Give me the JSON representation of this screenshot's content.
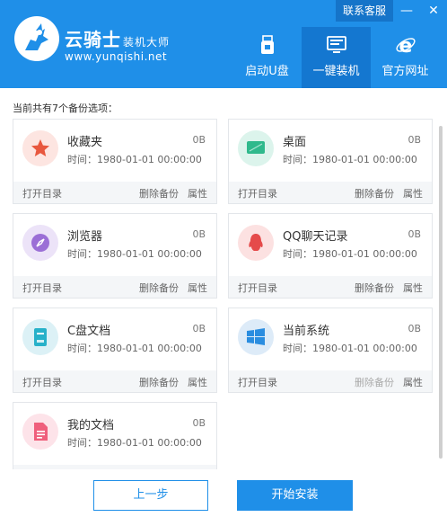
{
  "header": {
    "brand_name": "云骑士",
    "brand_sub": "装机大师",
    "brand_url": "www.yunqishi.net",
    "service_label": "联系客服",
    "minimize_glyph": "—",
    "close_glyph": "✕",
    "nav": [
      {
        "label": "启动U盘",
        "icon": "usb-drive-icon"
      },
      {
        "label": "一键装机",
        "icon": "monitor-icon",
        "active": true
      },
      {
        "label": "官方网址",
        "icon": "browser-ie-icon"
      }
    ]
  },
  "backup": {
    "count_text": "当前共有7个备份选项：",
    "time_prefix": "时间：",
    "open_label": "打开目录",
    "delete_label": "删除备份",
    "attr_label": "属性",
    "items": [
      {
        "name": "收藏夹",
        "size": "0B",
        "time": "1980-01-01 00:00:00",
        "icon": "star-icon",
        "color": "#e8573e"
      },
      {
        "name": "桌面",
        "size": "0B",
        "time": "1980-01-01 00:00:00",
        "icon": "desktop-icon",
        "color": "#2fb98c"
      },
      {
        "name": "浏览器",
        "size": "0B",
        "time": "1980-01-01 00:00:00",
        "icon": "compass-icon",
        "color": "#9b6fd6"
      },
      {
        "name": "QQ聊天记录",
        "size": "0B",
        "time": "1980-01-01 00:00:00",
        "icon": "qq-penguin-icon",
        "color": "#e54a4a"
      },
      {
        "name": "C盘文档",
        "size": "0B",
        "time": "1980-01-01 00:00:00",
        "icon": "document-icon",
        "color": "#27b1c9"
      },
      {
        "name": "当前系统",
        "size": "0B",
        "time": "1980-01-01 00:00:00",
        "icon": "windows-icon",
        "color": "#2a8de0"
      },
      {
        "name": "我的文档",
        "size": "0B",
        "time": "1980-01-01 00:00:00",
        "icon": "file-icon",
        "color": "#ef5f7c"
      }
    ]
  },
  "footer": {
    "prev_label": "上一步",
    "start_label": "开始安装"
  },
  "colors": {
    "primary": "#1f8fe8",
    "header_active": "#1477d0"
  }
}
